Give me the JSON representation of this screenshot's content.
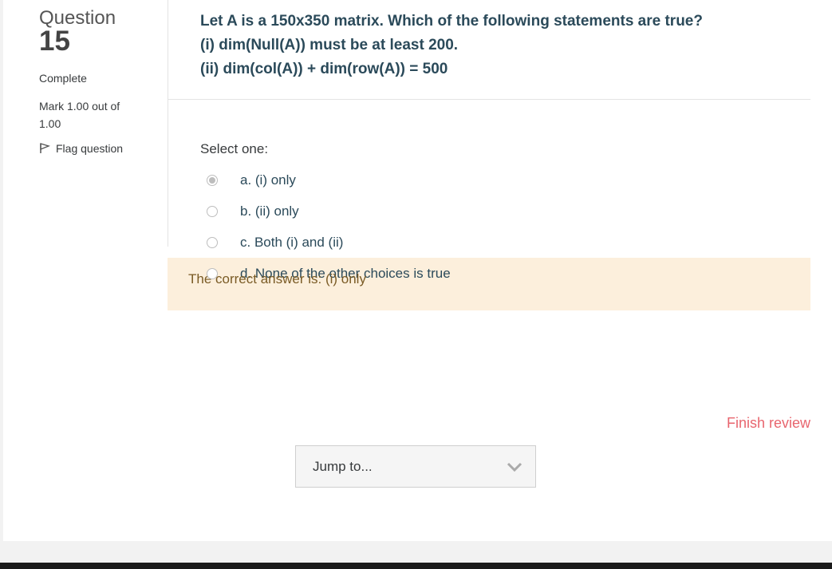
{
  "info": {
    "question_word": "Question",
    "question_number": "15",
    "state": "Complete",
    "grade": "Mark 1.00 out of 1.00",
    "flag_label": "Flag question"
  },
  "question": {
    "lines": [
      "Let A is a 150x350 matrix. Which of the following statements are true?",
      "(i) dim(Null(A)) must be at least 200.",
      "(ii) dim(col(A)) + dim(row(A)) = 500"
    ],
    "prompt": "Select one:",
    "options": [
      {
        "label": "a. (i) only",
        "selected": true
      },
      {
        "label": "b. (ii) only",
        "selected": false
      },
      {
        "label": "c. Both (i) and (ii)",
        "selected": false
      },
      {
        "label": "d. None of the other choices is true",
        "selected": false
      }
    ],
    "feedback": "The correct answer is: (i) only"
  },
  "nav": {
    "finish_review": "Finish review",
    "jump_to": "Jump to..."
  },
  "colors": {
    "question_text": "#2b4a5a",
    "feedback_bg": "#fcefdc",
    "finish_link": "#e8656e"
  }
}
